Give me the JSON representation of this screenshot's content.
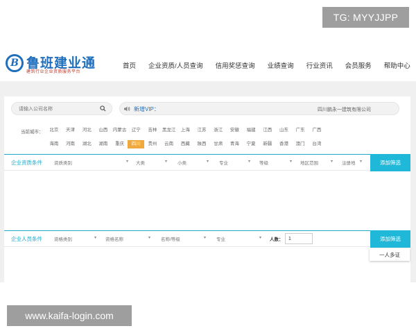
{
  "badges": {
    "tg": "TG: MYYJJPP",
    "url": "www.kaifa-login.com"
  },
  "logo": {
    "name": "鲁班建业通",
    "letter": "B",
    "slogan": "建筑行业企业资质服务平台"
  },
  "nav": [
    "首页",
    "企业资质/人员查询",
    "信用奖惩查询",
    "业绩查询",
    "行业资讯",
    "会员服务",
    "帮助中心"
  ],
  "search": {
    "placeholder": "请输入公司名称"
  },
  "vip": {
    "label": "新增VIP：",
    "company": "四川鹏永一建筑有限公司"
  },
  "region": {
    "label": "当前城市：",
    "rows": [
      [
        "北京",
        "天津",
        "河北",
        "山西",
        "内蒙古",
        "辽宁",
        "吉林",
        "黑龙江",
        "上海",
        "江苏",
        "浙江",
        "安徽",
        "福建",
        "江西",
        "山东",
        "广东",
        "广西"
      ],
      [
        "海南",
        "河南",
        "湖北",
        "湖南",
        "重庆",
        "四川",
        "贵州",
        "云南",
        "西藏",
        "陕西",
        "甘肃",
        "青海",
        "宁夏",
        "新疆",
        "香港",
        "澳门",
        "台湾"
      ]
    ],
    "active": "四川"
  },
  "company_filter": {
    "title": "企业资质条件",
    "selects": [
      "资质类别",
      "大类",
      "小类",
      "专业",
      "等级",
      "地区范围",
      "注册地"
    ],
    "button": "添加筛选"
  },
  "person_filter": {
    "title": "企业人员条件",
    "selects": [
      "资格类别",
      "资格名称",
      "名称/等级",
      "专业"
    ],
    "count_label": "人数：",
    "count_value": "1",
    "button": "添加筛选"
  },
  "tooltip": "一人多证",
  "colors": {
    "brand": "#1f6fbd",
    "accent": "#20b8d8",
    "active_region": "#f0a93e"
  }
}
